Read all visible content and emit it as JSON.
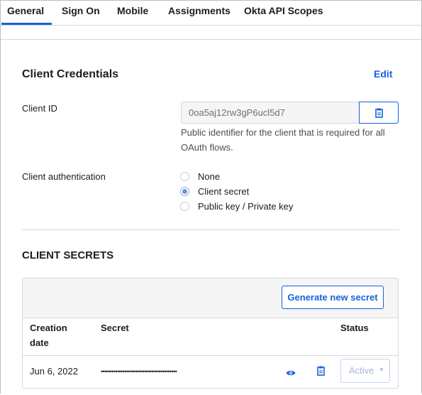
{
  "tabs": [
    {
      "label": "General",
      "active": true
    },
    {
      "label": "Sign On"
    },
    {
      "label": "Mobile"
    },
    {
      "label": "Assignments"
    },
    {
      "label": "Okta API Scopes"
    }
  ],
  "credentials": {
    "title": "Client Credentials",
    "edit_label": "Edit",
    "client_id_label": "Client ID",
    "client_id_value": "0oa5aj12rw3gP6ucl5d7",
    "client_id_help": "Public identifier for the client that is required for all OAuth flows.",
    "auth_label": "Client authentication",
    "auth_options": [
      {
        "label": "None",
        "selected": false
      },
      {
        "label": "Client secret",
        "selected": true
      },
      {
        "label": "Public key / Private key",
        "selected": false
      }
    ]
  },
  "secrets": {
    "title": "CLIENT SECRETS",
    "generate_label": "Generate new secret",
    "columns": {
      "creation": "Creation date",
      "secret": "Secret",
      "status": "Status"
    },
    "rows": [
      {
        "creation_date": "Jun 6, 2022",
        "secret_masked": "••••••••••••••••••••••••••••••••••••••••••",
        "status": "Active"
      }
    ]
  },
  "colors": {
    "accent": "#1662dd",
    "text": "#1d1d21",
    "muted": "#4d4d57",
    "border": "#d7d7dc"
  },
  "icons": {
    "copy": "clipboard-icon",
    "reveal": "eye-icon",
    "dropdown": "caret-down-icon"
  }
}
